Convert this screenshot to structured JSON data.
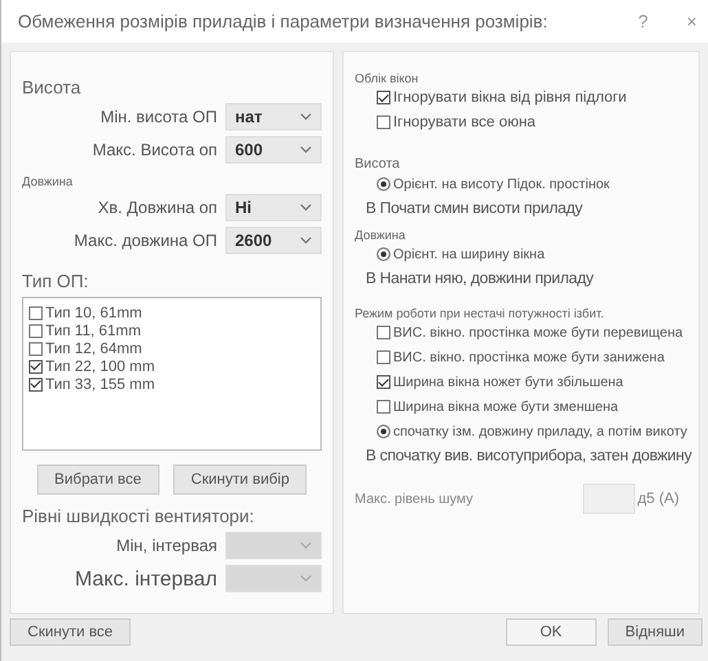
{
  "window": {
    "title": "Обмеження розмірів приладів і параметри визначення розмірів:",
    "help": "?",
    "close": "×"
  },
  "left": {
    "height": {
      "title": "Висота",
      "fields": [
        {
          "label": "Мін. висота ОП",
          "value": "нат",
          "disabled": false
        },
        {
          "label": "Макс. Висота оп",
          "value": "600",
          "disabled": false
        }
      ]
    },
    "length": {
      "title": "Довжина",
      "fields": [
        {
          "label": "Хв. Довжина оп",
          "value": "Hi",
          "disabled": false
        },
        {
          "label": "Макс. довжина ОП",
          "value": "2600",
          "disabled": false
        }
      ]
    },
    "types": {
      "title": "Тип ОП:",
      "items": [
        {
          "label": "Тип 10, 61mm",
          "checked": false
        },
        {
          "label": "Тип 11, 61mm",
          "checked": false
        },
        {
          "label": "Тип 12, 64mm",
          "checked": false
        },
        {
          "label": "Тип 22, 100 mm",
          "checked": true
        },
        {
          "label": "Тип 33, 155 mm",
          "checked": true
        }
      ]
    },
    "buttons": [
      "Вибрати все",
      "Скинути вибір"
    ],
    "fan": {
      "title": "Рівні швидкості вентиятори:",
      "fields": [
        {
          "label": "Мін, інтервая",
          "disabled": true
        },
        {
          "label": "Макс. інтервал",
          "disabled": true
        }
      ]
    }
  },
  "right": {
    "sections": [
      {
        "title": "Облік вікон",
        "items": [
          {
            "kind": "checkbox",
            "label": "Ігнорувати вікна від рівня підлоги",
            "checked": true
          },
          {
            "kind": "checkbox",
            "label": "Ігнорувати все оюна",
            "checked": false
          }
        ]
      },
      {
        "title": "Висота",
        "items": [
          {
            "kind": "radio",
            "label": "Орієнт. на висоту Підок. простінок",
            "selected": true
          },
          {
            "kind": "text",
            "label": "В Почати смин висоти приладу"
          }
        ]
      },
      {
        "title": "Довжина",
        "items": [
          {
            "kind": "radio",
            "label": "Орієнт. на ширину вікна",
            "selected": true
          },
          {
            "kind": "text",
            "label": "В Нанати няю, довжини приладу"
          }
        ]
      },
      {
        "title": "Режим роботи при нестачі потужності ізбит.",
        "items": [
          {
            "kind": "checkbox",
            "label": "ВИС. вікно. простінка може бути перевищена",
            "checked": false
          },
          {
            "kind": "checkbox",
            "label": "ВИС. вікно. простінка може бути занижена",
            "checked": false
          },
          {
            "kind": "checkbox",
            "label": "Ширина вікна ножет бути збільшена",
            "checked": true
          },
          {
            "kind": "checkbox",
            "label": "Ширина вікна може бути зменшена",
            "checked": false
          },
          {
            "kind": "radio",
            "label": "спочатку ізм. довжину приладу, а потім викоту",
            "selected": true
          },
          {
            "kind": "text",
            "label": "В спочатку вив. висотуприбора, затен довжину"
          }
        ]
      }
    ],
    "noise": {
      "label": "Макс. рівень шуму",
      "unit": "д5 (А)"
    }
  },
  "footer": {
    "reset": "Скинути все",
    "ok": "OK",
    "cancel": "Відняши"
  }
}
